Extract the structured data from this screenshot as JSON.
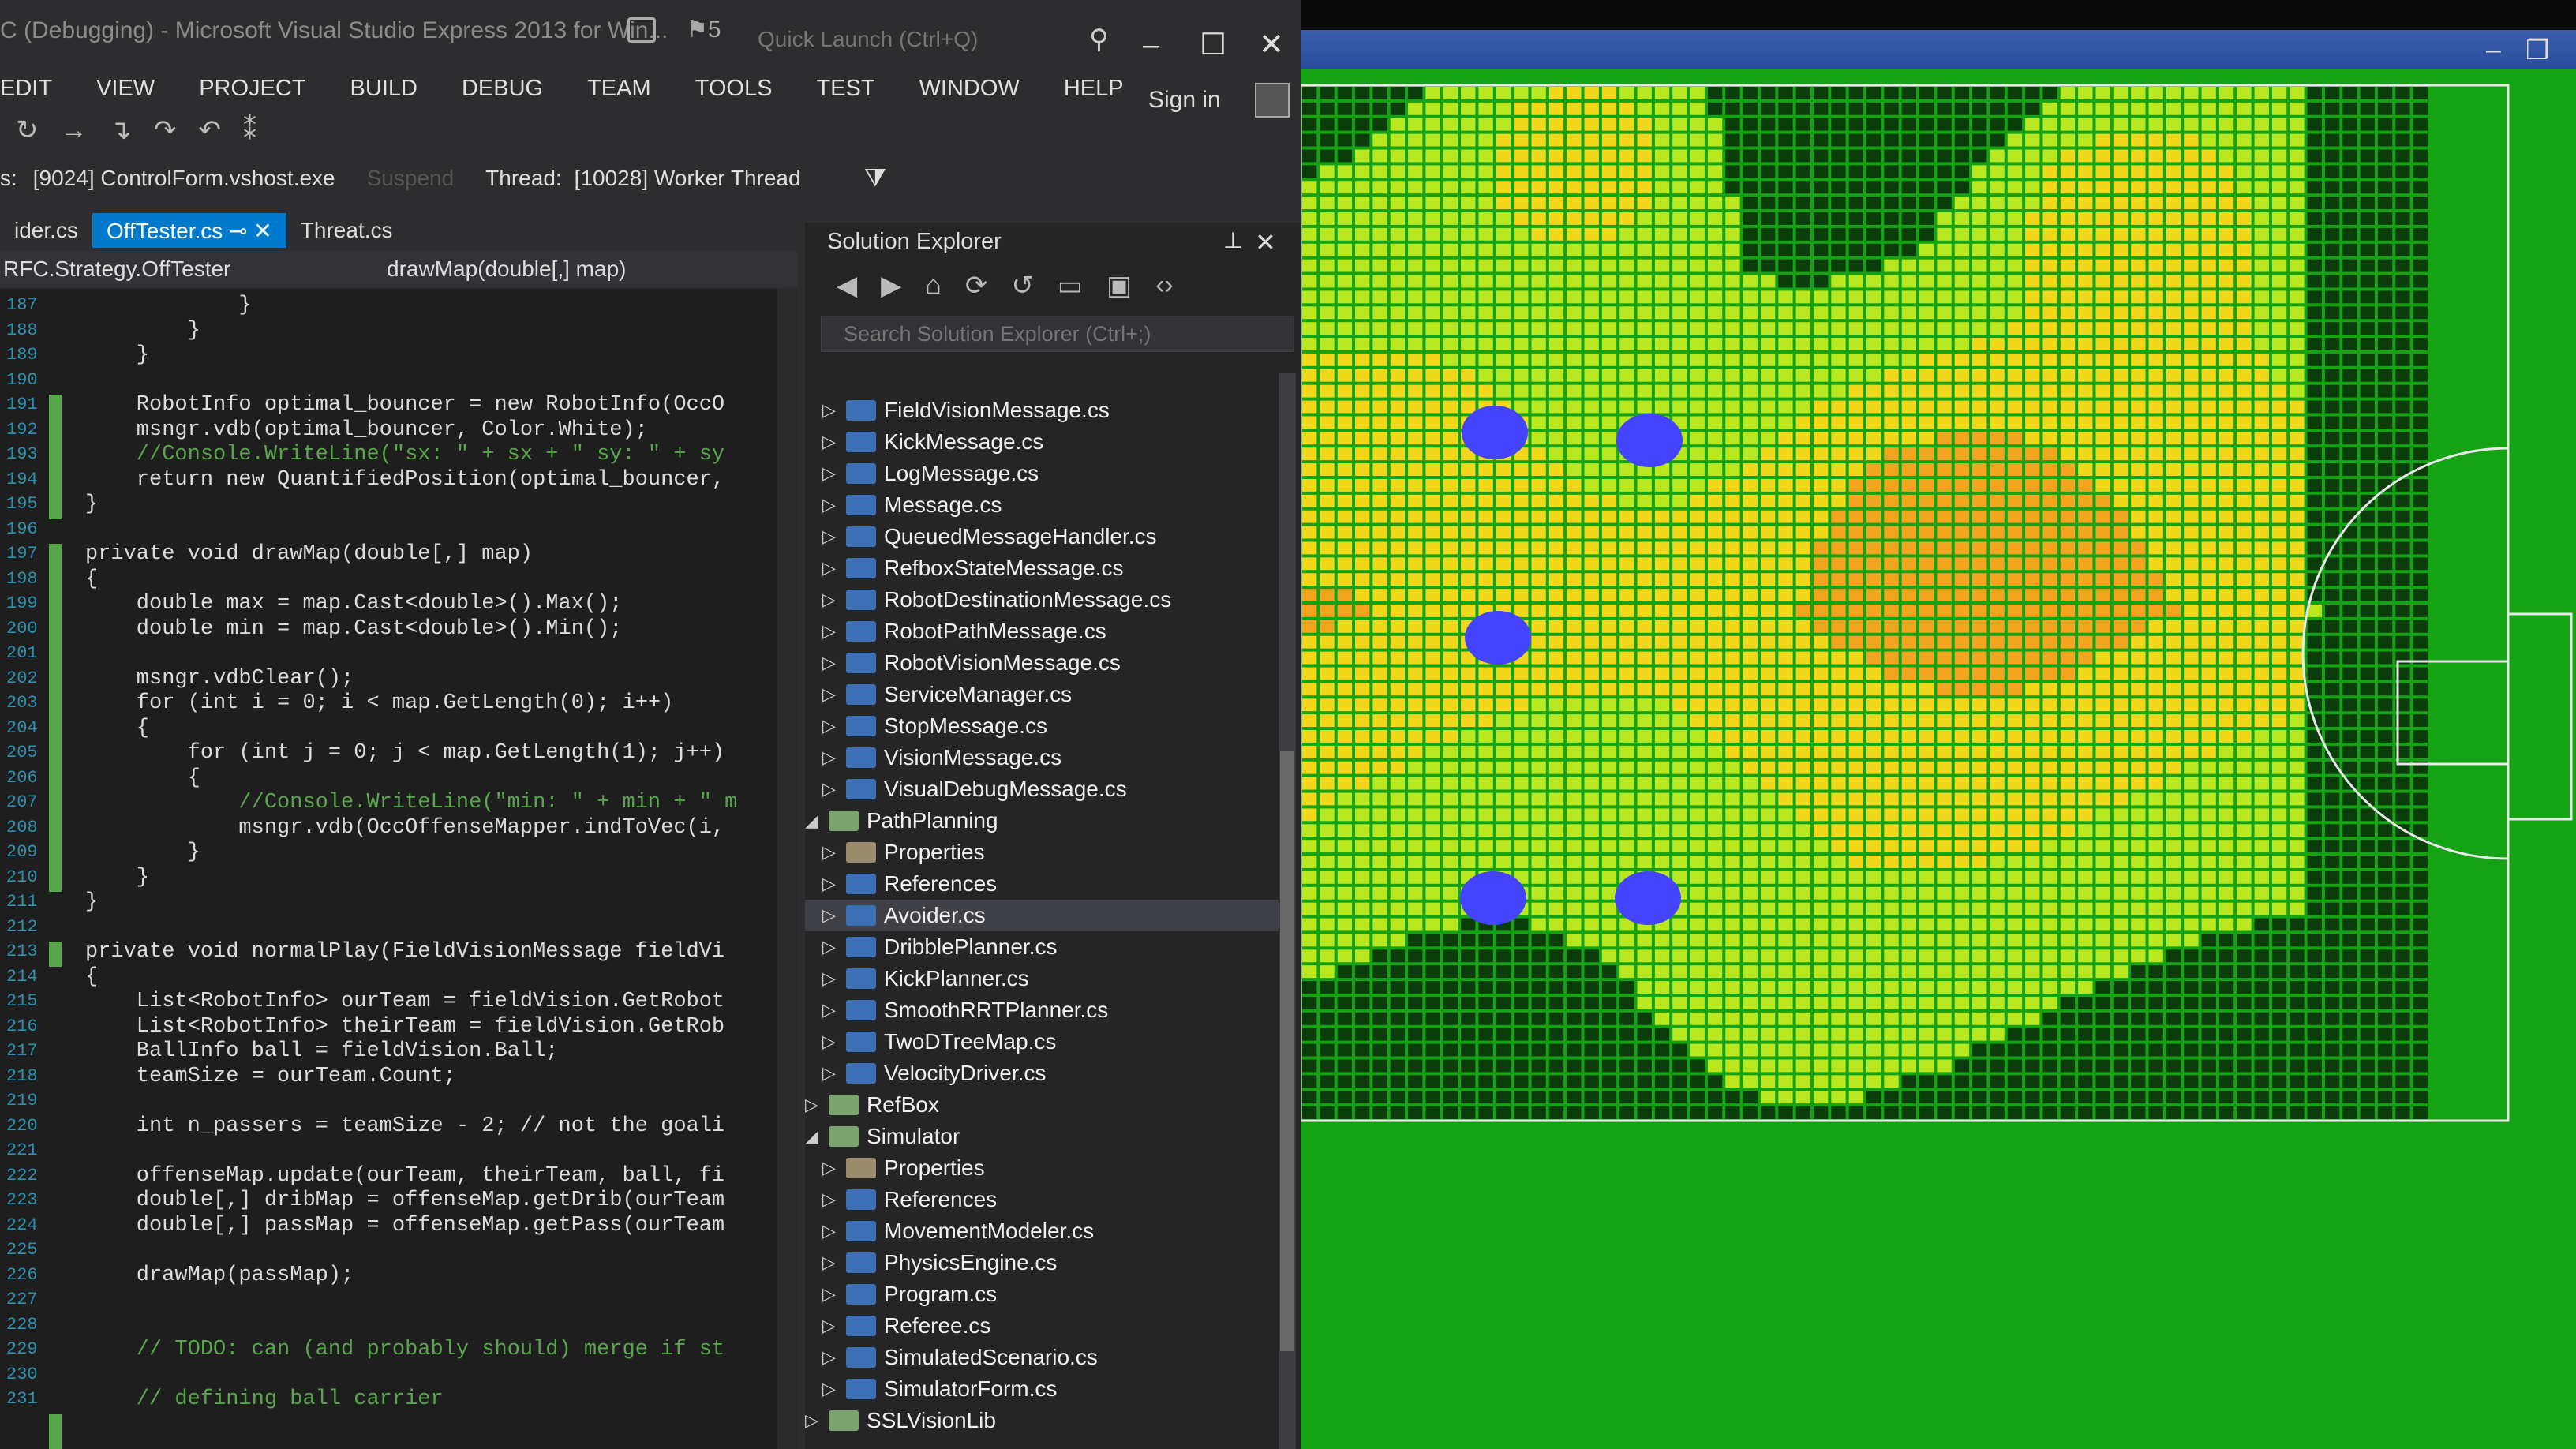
{
  "vs": {
    "title": "C (Debugging) - Microsoft Visual Studio Express 2013 for Win...",
    "flag_count": "5",
    "quick_launch_placeholder": "Quick Launch (Ctrl+Q)",
    "menu": [
      "EDIT",
      "VIEW",
      "PROJECT",
      "BUILD",
      "DEBUG",
      "TEAM",
      "TOOLS",
      "TEST",
      "WINDOW",
      "HELP"
    ],
    "sign_in": "Sign in",
    "debug": {
      "process_label": "s:",
      "process": "[9024] ControlForm.vshost.exe",
      "suspend": "Suspend",
      "thread_label": "Thread:",
      "thread": "[10028] Worker Thread"
    },
    "tabs": [
      "ider.cs",
      "OffTester.cs",
      "Threat.cs"
    ],
    "active_tab": "OffTester.cs",
    "nav_class": "RFC.Strategy.OffTester",
    "nav_member": "drawMap(double[,] map)",
    "line_numbers": [
      "187",
      "188",
      "189",
      "190",
      "191",
      "192",
      "193",
      "194",
      "195",
      "196",
      "197",
      "198",
      "199",
      "200",
      "201",
      "202",
      "203",
      "204",
      "205",
      "206",
      "207",
      "208",
      "209",
      "210",
      "211",
      "212",
      "213",
      "214",
      "215",
      "216",
      "217",
      "218",
      "219",
      "220",
      "221",
      "222",
      "223",
      "224",
      "225",
      "226",
      "227",
      "228",
      "229",
      "230",
      "231"
    ],
    "code_lines": [
      "            }",
      "        }",
      "    }",
      "",
      "    RobotInfo optimal_bouncer = new RobotInfo(OccO",
      "    msngr.vdb(optimal_bouncer, Color.White);",
      "    //Console.WriteLine(\"sx: \" + sx + \" sy: \" + sy",
      "    return new QuantifiedPosition(optimal_bouncer,",
      "}",
      "",
      "private void drawMap(double[,] map)",
      "{",
      "    double max = map.Cast<double>().Max();",
      "    double min = map.Cast<double>().Min();",
      "",
      "    msngr.vdbClear();",
      "    for (int i = 0; i < map.GetLength(0); i++)",
      "    {",
      "        for (int j = 0; j < map.GetLength(1); j++)",
      "        {",
      "            //Console.WriteLine(\"min: \" + min + \" m",
      "            msngr.vdb(OccOffenseMapper.indToVec(i,",
      "        }",
      "    }",
      "}",
      "",
      "private void normalPlay(FieldVisionMessage fieldVi",
      "{",
      "    List<RobotInfo> ourTeam = fieldVision.GetRobot",
      "    List<RobotInfo> theirTeam = fieldVision.GetRob",
      "    BallInfo ball = fieldVision.Ball;",
      "    teamSize = ourTeam.Count;",
      "",
      "    int n_passers = teamSize - 2; // not the goali",
      "",
      "    offenseMap.update(ourTeam, theirTeam, ball, fi",
      "    double[,] dribMap = offenseMap.getDrib(ourTeam",
      "    double[,] passMap = offenseMap.getPass(ourTeam",
      "",
      "    drawMap(passMap);",
      "",
      "",
      "    // TODO: can (and probably should) merge if st",
      "",
      "    // defining ball carrier"
    ]
  },
  "solution_explorer": {
    "title": "Solution Explorer",
    "search_placeholder": "Search Solution Explorer (Ctrl+;)",
    "items": [
      {
        "label": "FieldVisionMessage.cs",
        "level": 2,
        "kind": "cs"
      },
      {
        "label": "KickMessage.cs",
        "level": 2,
        "kind": "cs"
      },
      {
        "label": "LogMessage.cs",
        "level": 2,
        "kind": "cs"
      },
      {
        "label": "Message.cs",
        "level": 2,
        "kind": "cs"
      },
      {
        "label": "QueuedMessageHandler.cs",
        "level": 2,
        "kind": "cs"
      },
      {
        "label": "RefboxStateMessage.cs",
        "level": 2,
        "kind": "cs"
      },
      {
        "label": "RobotDestinationMessage.cs",
        "level": 2,
        "kind": "cs"
      },
      {
        "label": "RobotPathMessage.cs",
        "level": 2,
        "kind": "cs"
      },
      {
        "label": "RobotVisionMessage.cs",
        "level": 2,
        "kind": "cs"
      },
      {
        "label": "ServiceManager.cs",
        "level": 2,
        "kind": "cs"
      },
      {
        "label": "StopMessage.cs",
        "level": 2,
        "kind": "cs"
      },
      {
        "label": "VisionMessage.cs",
        "level": 2,
        "kind": "cs"
      },
      {
        "label": "VisualDebugMessage.cs",
        "level": 2,
        "kind": "cs"
      },
      {
        "label": "PathPlanning",
        "level": 1,
        "kind": "proj"
      },
      {
        "label": "Properties",
        "level": 2,
        "kind": "prop"
      },
      {
        "label": "References",
        "level": 2,
        "kind": "ref"
      },
      {
        "label": "Avoider.cs",
        "level": 2,
        "kind": "cs",
        "selected": true
      },
      {
        "label": "DribblePlanner.cs",
        "level": 2,
        "kind": "cs"
      },
      {
        "label": "KickPlanner.cs",
        "level": 2,
        "kind": "cs"
      },
      {
        "label": "SmoothRRTPlanner.cs",
        "level": 2,
        "kind": "cs"
      },
      {
        "label": "TwoDTreeMap.cs",
        "level": 2,
        "kind": "cs"
      },
      {
        "label": "VelocityDriver.cs",
        "level": 2,
        "kind": "cs"
      },
      {
        "label": "RefBox",
        "level": 1,
        "kind": "proj"
      },
      {
        "label": "Simulator",
        "level": 1,
        "kind": "proj"
      },
      {
        "label": "Properties",
        "level": 2,
        "kind": "prop"
      },
      {
        "label": "References",
        "level": 2,
        "kind": "ref"
      },
      {
        "label": "MovementModeler.cs",
        "level": 2,
        "kind": "cs"
      },
      {
        "label": "PhysicsEngine.cs",
        "level": 2,
        "kind": "cs"
      },
      {
        "label": "Program.cs",
        "level": 2,
        "kind": "cs"
      },
      {
        "label": "Referee.cs",
        "level": 2,
        "kind": "cs"
      },
      {
        "label": "SimulatedScenario.cs",
        "level": 2,
        "kind": "cs"
      },
      {
        "label": "SimulatorForm.cs",
        "level": 2,
        "kind": "cs"
      },
      {
        "label": "SSLVisionLib",
        "level": 1,
        "kind": "proj"
      }
    ]
  },
  "simulator": {
    "colors": {
      "field": "#15a315",
      "map_low": "#0b3d0b",
      "map_mid1": "#b9e820",
      "map_mid2": "#f1d81a",
      "map_mid3": "#f3a520",
      "map_high": "#e85a14",
      "robot": "#4444ff"
    },
    "robot_count": 5
  }
}
